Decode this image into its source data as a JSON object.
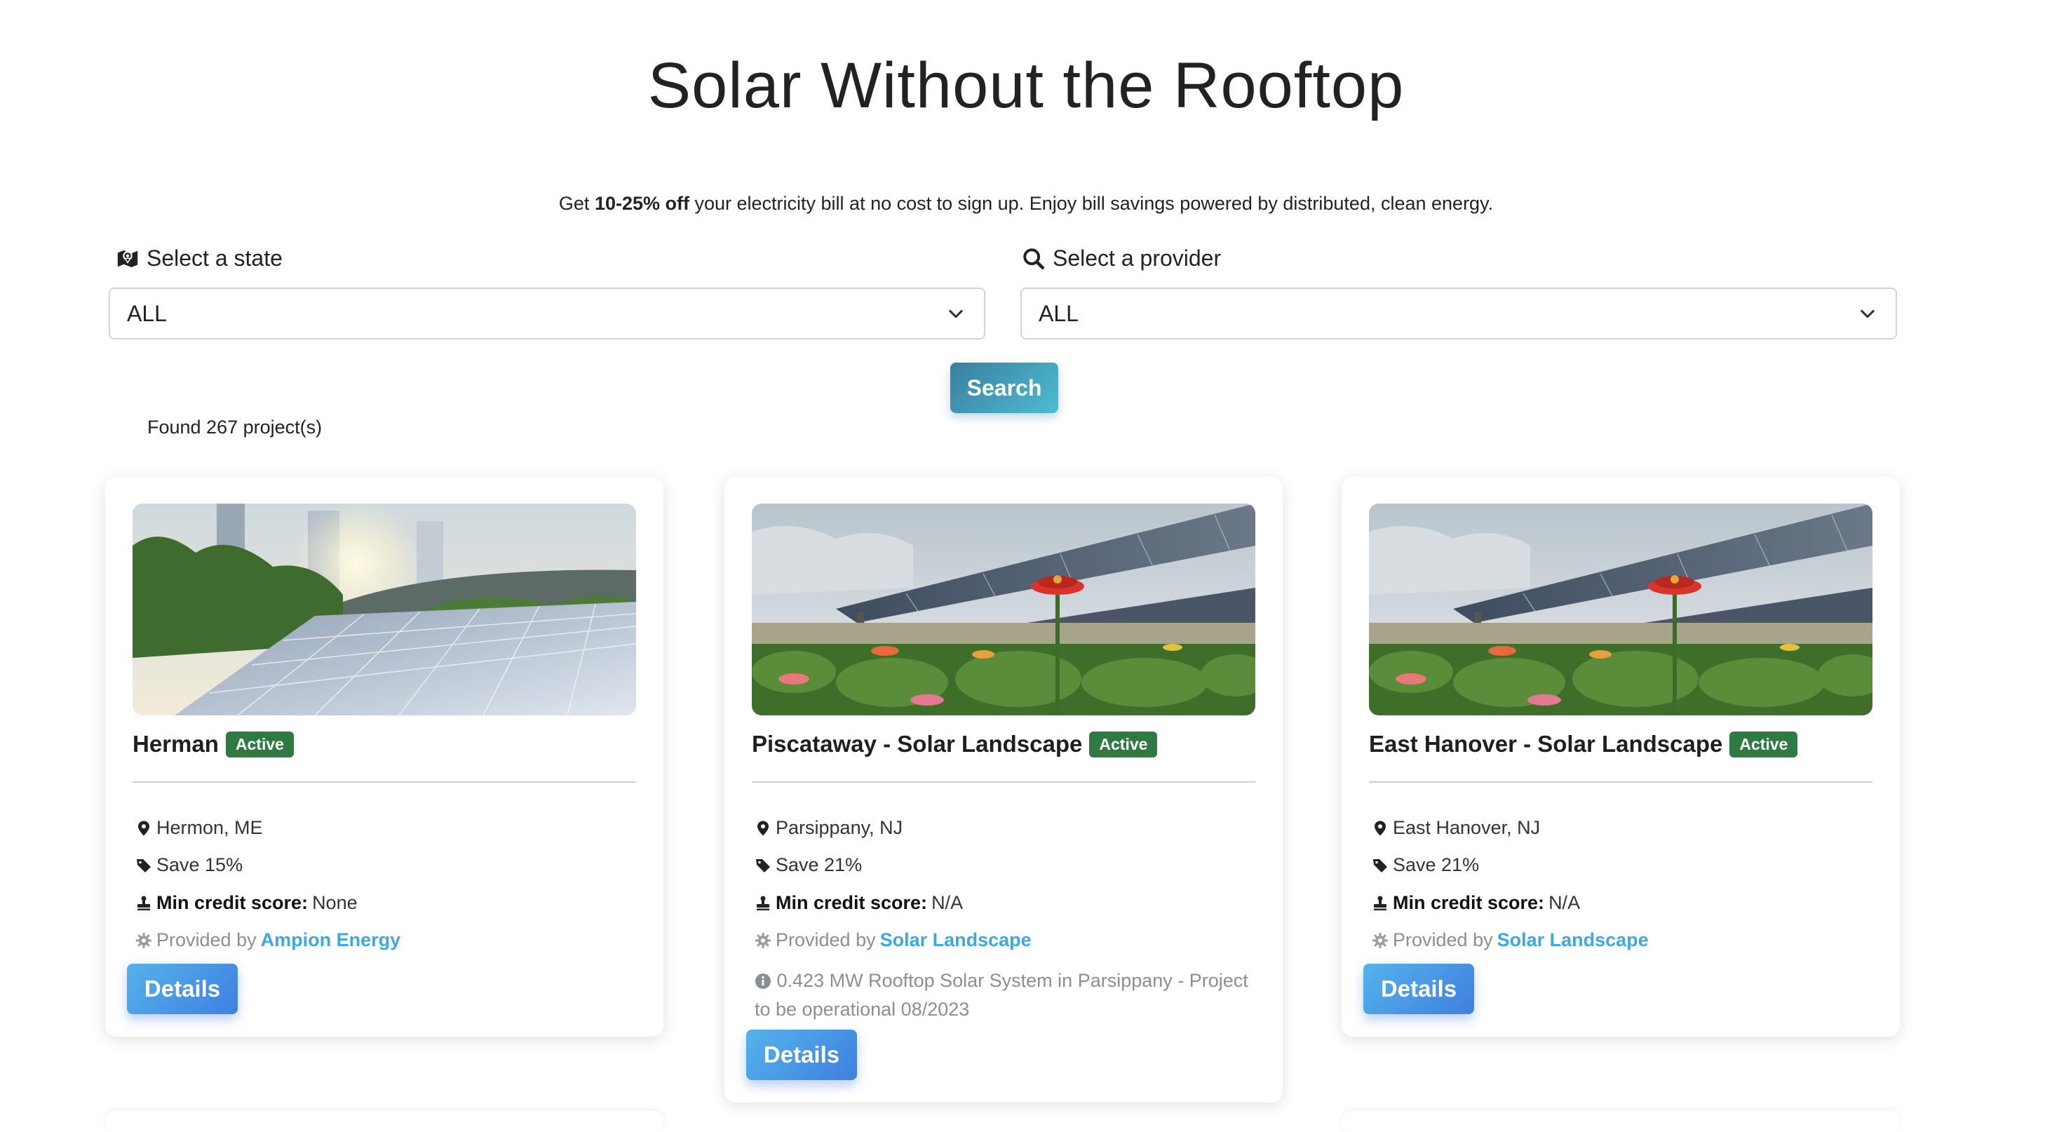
{
  "header": {
    "title": "Solar Without the Rooftop",
    "subtitle_prefix": "Get ",
    "subtitle_bold": "10-25% off",
    "subtitle_suffix": " your electricity bill at no cost to sign up. Enjoy bill savings powered by distributed, clean energy."
  },
  "filters": {
    "state_label": "Select a state",
    "state_value": "ALL",
    "provider_label": "Select a provider",
    "provider_value": "ALL",
    "search_label": "Search"
  },
  "results": {
    "found_text": "Found 267 project(s)"
  },
  "cards": [
    {
      "title": "Herman",
      "status": "Active",
      "location": "Hermon, ME",
      "savings": "Save 15%",
      "credit_label": "Min credit score:",
      "credit_value": " None",
      "provided_by": "Provided by ",
      "provider": "Ampion Energy",
      "description": "",
      "details_label": "Details"
    },
    {
      "title": "Piscataway - Solar Landscape",
      "status": "Active",
      "location": "Parsippany, NJ",
      "savings": "Save 21%",
      "credit_label": "Min credit score:",
      "credit_value": " N/A",
      "provided_by": "Provided by ",
      "provider": "Solar Landscape",
      "description": "0.423 MW Rooftop Solar System in Parsippany - Project to be operational 08/2023",
      "details_label": "Details"
    },
    {
      "title": "East Hanover - Solar Landscape",
      "status": "Active",
      "location": "East Hanover, NJ",
      "savings": "Save 21%",
      "credit_label": "Min credit score:",
      "credit_value": " N/A",
      "provided_by": "Provided by ",
      "provider": "Solar Landscape",
      "description": "",
      "details_label": "Details"
    }
  ],
  "icons": {
    "state": "map-icon",
    "provider": "search-icon",
    "dropdown": "chevron-down-icon",
    "location": "map-pin-icon",
    "savings": "tag-icon",
    "credit": "stamp-icon",
    "provider_row": "gear-icon",
    "description": "info-circle-icon"
  },
  "colors": {
    "badge": "#2f7a42",
    "link": "#3ea9e0",
    "search_button": "#3a7f9f",
    "details_button": "#4a9ae6"
  }
}
